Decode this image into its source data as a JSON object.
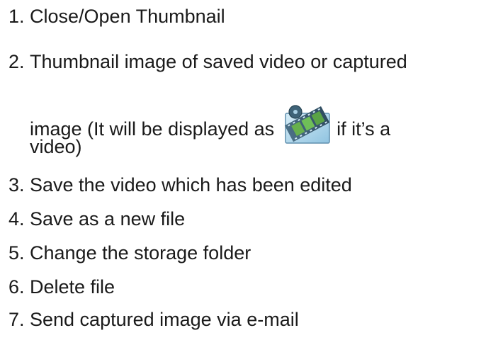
{
  "items": [
    {
      "number": "1.",
      "text": "Close/Open Thumbnail"
    },
    {
      "number": "2.",
      "text": "Thumbnail image of saved video or captured"
    },
    {
      "number": "3.",
      "text": "Save the video which has been edited"
    },
    {
      "number": "4.",
      "text": "Save as a new file"
    },
    {
      "number": "5.",
      "text": "Change the storage folder"
    },
    {
      "number": "6.",
      "text": "Delete file"
    },
    {
      "number": "7.",
      "text": "Send captured image via e-mail"
    }
  ],
  "item2_continuation": {
    "before_icon": "image (It will be displayed as",
    "after_icon": "if it’s a",
    "last_line": "video)"
  },
  "icons": {
    "video_icon": "film-reel-icon"
  }
}
